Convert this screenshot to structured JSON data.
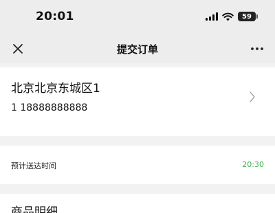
{
  "status_bar": {
    "time": "20:01",
    "battery": "59",
    "icons": [
      "signal-icon",
      "wifi-icon",
      "battery-icon"
    ]
  },
  "nav": {
    "title": "提交订单",
    "close_icon": "close-icon",
    "more_icon": "more-icon"
  },
  "address": {
    "line": "北京北京东城区1",
    "contact": "1 18888888888",
    "chevron_icon": "chevron-right-icon"
  },
  "delivery": {
    "label": "预计送达时间",
    "time": "20:30",
    "time_color": "#3bb34a"
  },
  "details": {
    "title": "商品明细"
  }
}
